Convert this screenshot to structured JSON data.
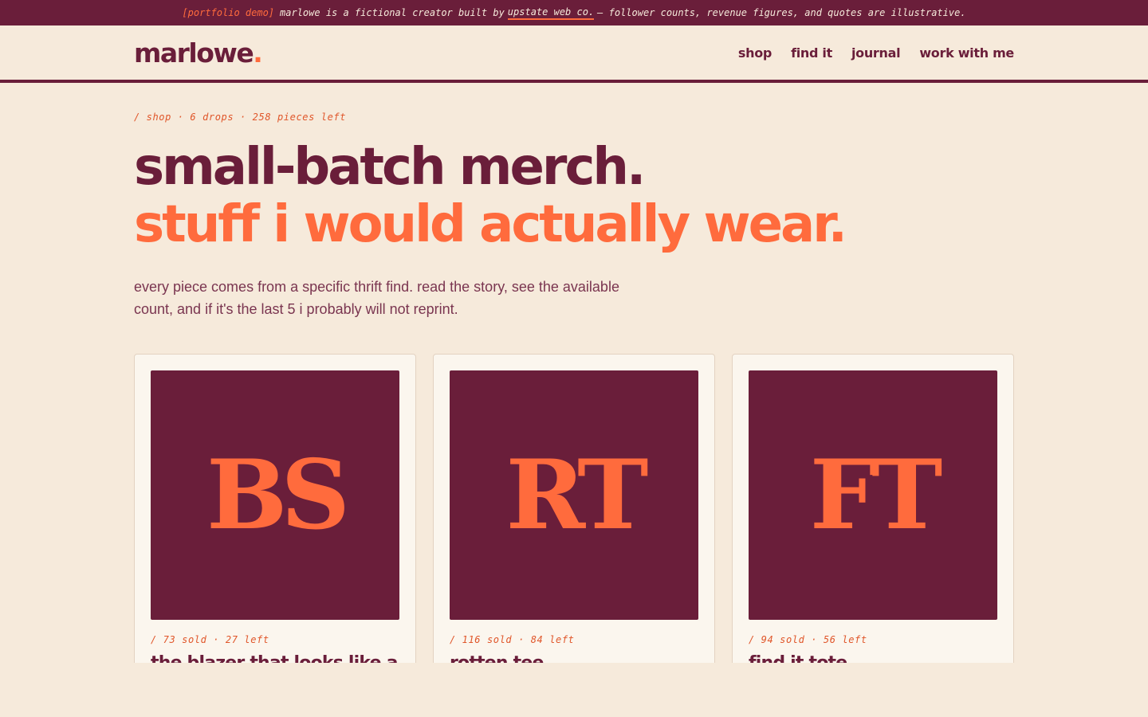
{
  "banner": {
    "tag": "[portfolio demo]",
    "text_before": "marlowe is a fictional creator built by",
    "link": "upstate web co.",
    "text_after": "— follower counts, revenue figures, and quotes are illustrative."
  },
  "header": {
    "logo": "marlowe",
    "logo_dot": ".",
    "nav": [
      "shop",
      "find it",
      "journal",
      "work with me"
    ]
  },
  "hero": {
    "crumb": "/ shop · 6 drops · 258 pieces left",
    "line1": "small-batch merch.",
    "line2": "stuff i would actually wear.",
    "sub": "every piece comes from a specific thrift find. read the story, see the available count, and if it's the last 5 i probably will not reprint."
  },
  "products": [
    {
      "initials": "BS",
      "meta": "/ 73 sold · 27 left",
      "title": "the blazer that looks like a"
    },
    {
      "initials": "RT",
      "meta": "/ 116 sold · 84 left",
      "title": "rotten tee"
    },
    {
      "initials": "FT",
      "meta": "/ 94 sold · 56 left",
      "title": "find it tote"
    }
  ],
  "colors": {
    "plum": "#6a1e3a",
    "orange": "#ff6b3d",
    "cream": "#f6eadb"
  }
}
